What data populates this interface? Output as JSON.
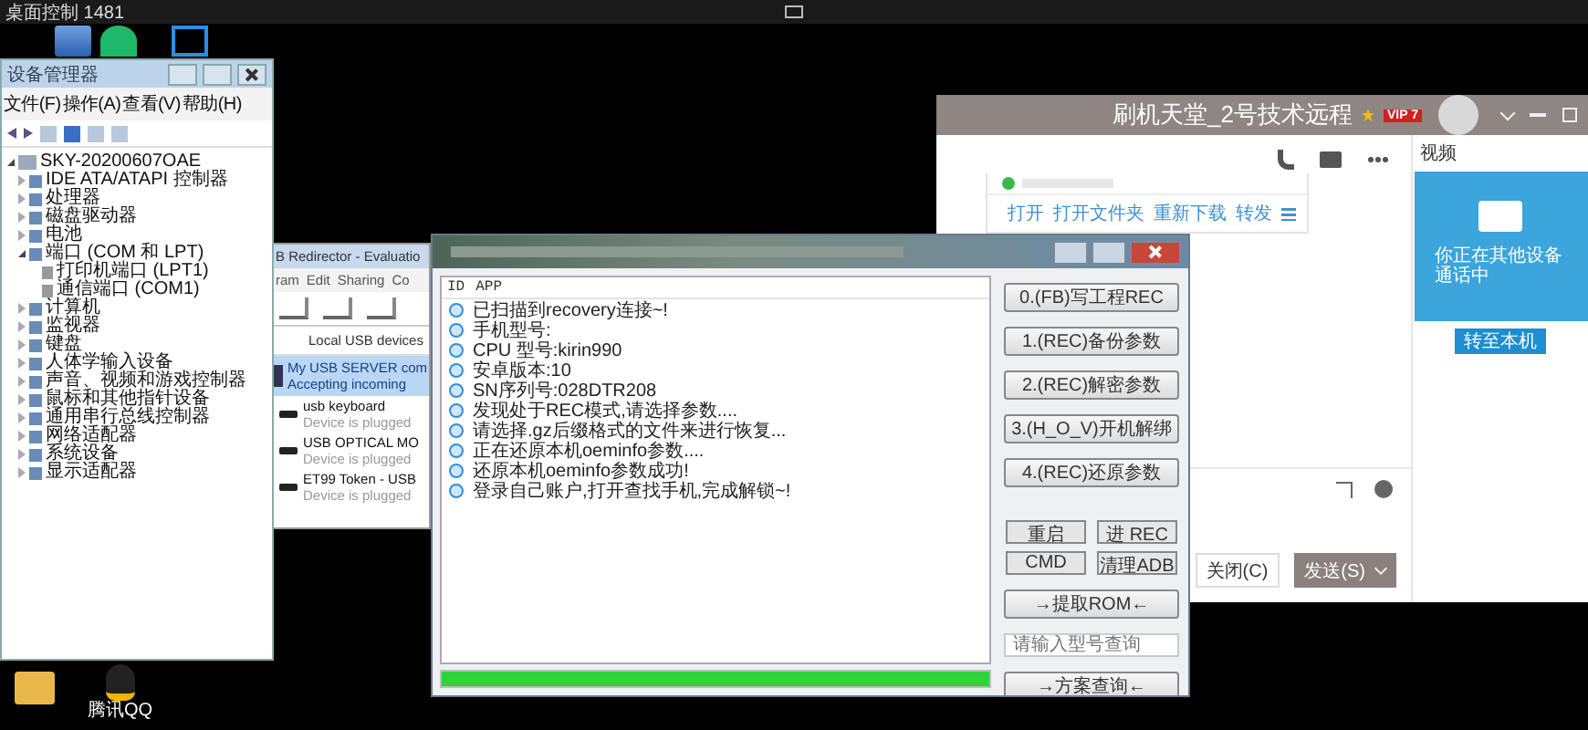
{
  "top_bar": {
    "title": "桌面控制 1481"
  },
  "device_manager": {
    "title": "设备管理器",
    "menu": [
      "文件(F)",
      "操作(A)",
      "查看(V)",
      "帮助(H)"
    ],
    "tree": [
      {
        "label": "SKY-20200607OAE",
        "expanded": true,
        "children": [
          {
            "label": "IDE ATA/ATAPI 控制器",
            "expanded": false
          },
          {
            "label": "处理器",
            "expanded": false
          },
          {
            "label": "磁盘驱动器",
            "expanded": false
          },
          {
            "label": "电池",
            "expanded": false
          },
          {
            "label": "端口 (COM 和 LPT)",
            "expanded": true,
            "children": [
              {
                "label": "打印机端口 (LPT1)"
              },
              {
                "label": "通信端口 (COM1)"
              }
            ]
          },
          {
            "label": "计算机",
            "expanded": false
          },
          {
            "label": "监视器",
            "expanded": false
          },
          {
            "label": "键盘",
            "expanded": false
          },
          {
            "label": "人体学输入设备",
            "expanded": false
          },
          {
            "label": "声音、视频和游戏控制器",
            "expanded": false
          },
          {
            "label": "鼠标和其他指针设备",
            "expanded": false
          },
          {
            "label": "通用串行总线控制器",
            "expanded": false
          },
          {
            "label": "网络适配器",
            "expanded": false
          },
          {
            "label": "系统设备",
            "expanded": false
          },
          {
            "label": "显示适配器",
            "expanded": false
          }
        ]
      }
    ]
  },
  "usb_redirector": {
    "title": "B Redirector - Evaluatio",
    "menu": [
      "ram",
      "Edit",
      "Sharing",
      "Co"
    ],
    "group_header": "Local USB devices",
    "server": {
      "name": "My USB SERVER com",
      "status": "Accepting incoming",
      "selected": true
    },
    "devices": [
      {
        "name": "usb keyboard",
        "status": "Device is plugged"
      },
      {
        "name": "USB OPTICAL MO",
        "status": "Device is plugged"
      },
      {
        "name": "ET99 Token - USB",
        "status": "Device is plugged"
      }
    ]
  },
  "flash_tool": {
    "columns": [
      "ID",
      "APP"
    ],
    "log": [
      "已扫描到recovery连接~!",
      "手机型号:",
      "CPU 型号:kirin990",
      "安卓版本:10",
      "SN序列号:028DTR208",
      "发现处于REC模式,请选择参数....",
      "请选择.gz后缀格式的文件来进行恢复...",
      "正在还原本机oeminfo参数....",
      "还原本机oeminfo参数成功!",
      "登录自己账户,打开查找手机,完成解锁~!"
    ],
    "actions": [
      "0.(FB)写工程REC",
      "1.(REC)备份参数",
      "2.(REC)解密参数",
      "3.(H_O_V)开机解绑",
      "4.(REC)还原参数"
    ],
    "small_actions": [
      "重启",
      "进 REC",
      "CMD",
      "清理ADB"
    ],
    "extract_button": "→提取ROM←",
    "model_search": {
      "placeholder": "请输入型号查询"
    },
    "search_button": "→方案查询←",
    "progress": {
      "level": 1
    }
  },
  "qq_chat": {
    "title": "刷机天堂_2号技术远程",
    "vip_badge": "VIP 7",
    "file_actions": [
      "打开",
      "打开文件夹",
      "重新下载",
      "转发"
    ],
    "side_panel": {
      "label": "视频",
      "call_status": "你正在其他设备通话中",
      "transfer_button": "转至本机"
    },
    "close_button": "关闭(C)",
    "send_button": "发送(S)"
  },
  "qq_shortcut": {
    "label": "腾讯QQ"
  }
}
